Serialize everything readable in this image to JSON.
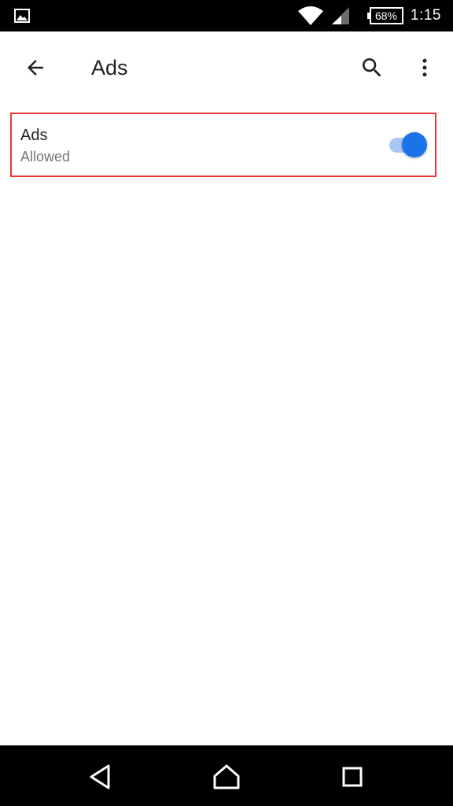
{
  "status_bar": {
    "battery": "68%",
    "time": "1:15",
    "icons": [
      "gallery-icon",
      "wifi-icon",
      "cell-signal-icon",
      "battery-icon"
    ]
  },
  "app_bar": {
    "title": "Ads",
    "icons": [
      "back-arrow-icon",
      "search-icon",
      "more-vert-icon"
    ]
  },
  "setting": {
    "title": "Ads",
    "subtitle": "Allowed",
    "toggle_on": true
  },
  "nav_bar": {
    "icons": [
      "nav-back-icon",
      "nav-home-icon",
      "nav-recents-icon"
    ]
  },
  "colors": {
    "accent": "#1a73e8",
    "track": "#a9c7f5",
    "highlight_border": "#e53935",
    "text_primary": "#212121",
    "text_secondary": "#757575"
  }
}
